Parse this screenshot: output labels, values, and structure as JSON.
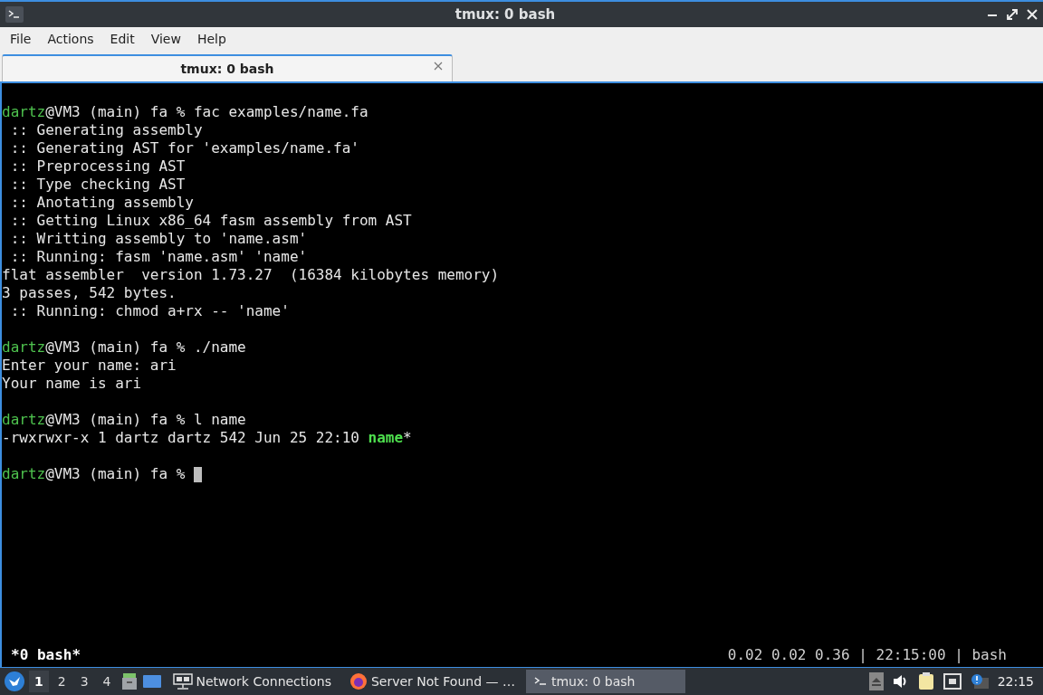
{
  "window": {
    "title": "tmux: 0 bash"
  },
  "menu": [
    "File",
    "Actions",
    "Edit",
    "View",
    "Help"
  ],
  "tabs": [
    {
      "label": "tmux: 0 bash",
      "selected": true
    }
  ],
  "terminal": {
    "lines": [
      {
        "kind": "prompt",
        "user": "dartz",
        "rest": "@VM3 (main) fa % fac examples/name.fa"
      },
      {
        "kind": "output",
        "text": " :: Generating assembly"
      },
      {
        "kind": "output",
        "text": " :: Generating AST for 'examples/name.fa'"
      },
      {
        "kind": "output",
        "text": " :: Preprocessing AST"
      },
      {
        "kind": "output",
        "text": " :: Type checking AST"
      },
      {
        "kind": "output",
        "text": " :: Anotating assembly"
      },
      {
        "kind": "output",
        "text": " :: Getting Linux x86_64 fasm assembly from AST"
      },
      {
        "kind": "output",
        "text": " :: Writting assembly to 'name.asm'"
      },
      {
        "kind": "output",
        "text": " :: Running: fasm 'name.asm' 'name'"
      },
      {
        "kind": "output",
        "text": "flat assembler  version 1.73.27  (16384 kilobytes memory)"
      },
      {
        "kind": "output",
        "text": "3 passes, 542 bytes."
      },
      {
        "kind": "output",
        "text": " :: Running: chmod a+rx -- 'name'"
      },
      {
        "kind": "blank"
      },
      {
        "kind": "prompt",
        "user": "dartz",
        "rest": "@VM3 (main) fa % ./name"
      },
      {
        "kind": "output",
        "text": "Enter your name: ari"
      },
      {
        "kind": "output",
        "text": "Your name is ari"
      },
      {
        "kind": "blank"
      },
      {
        "kind": "prompt",
        "user": "dartz",
        "rest": "@VM3 (main) fa % l name"
      },
      {
        "kind": "listing",
        "text": "-rwxrwxr-x 1 dartz dartz 542 Jun 25 22:10 ",
        "exec": "name",
        "suffix": "*"
      },
      {
        "kind": "blank"
      },
      {
        "kind": "prompt",
        "user": "dartz",
        "rest": "@VM3 (main) fa % ",
        "cursor": true
      }
    ],
    "status_left": "*0 bash*",
    "status_right": "0.02 0.02 0.36 | 22:15:00 | bash"
  },
  "taskbar": {
    "workspaces": [
      {
        "label": "1",
        "selected": true
      },
      {
        "label": "2",
        "selected": false
      },
      {
        "label": "3",
        "selected": false
      },
      {
        "label": "4",
        "selected": false
      }
    ],
    "tasks": [
      {
        "kind": "network",
        "label": "Network Connections",
        "selected": false
      },
      {
        "kind": "firefox",
        "label": "Server Not Found — …",
        "selected": false
      },
      {
        "kind": "terminal",
        "label": "tmux: 0 bash",
        "selected": true
      }
    ],
    "clock": "22:15"
  }
}
